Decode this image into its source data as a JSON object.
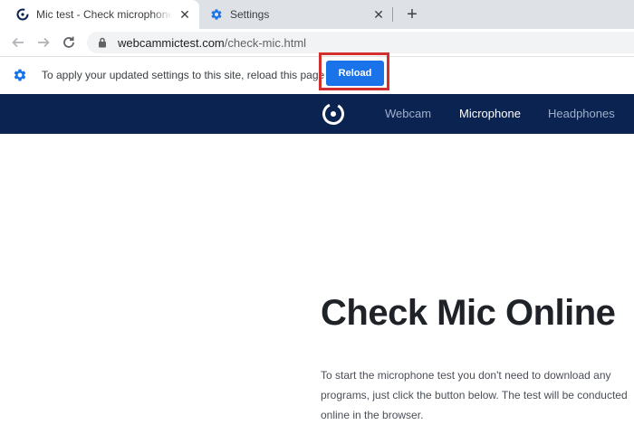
{
  "browser": {
    "tabs": [
      {
        "title": "Mic test - Check microphone online",
        "icon": "site-logo-icon",
        "active": true
      },
      {
        "title": "Settings",
        "icon": "gear-icon",
        "active": false
      }
    ],
    "new_tab_symbol": "+",
    "close_symbol": "✕",
    "address": {
      "host": "webcammictest.com",
      "path": "/check-mic.html"
    }
  },
  "infobar": {
    "message": "To apply your updated settings to this site, reload this page",
    "button_label": "Reload"
  },
  "site_nav": {
    "items": [
      {
        "label": "Webcam"
      },
      {
        "label": "Microphone",
        "current": true
      },
      {
        "label": "Headphones"
      }
    ]
  },
  "main": {
    "heading": "Check Mic Online",
    "intro": "To start the microphone test you don't need to download any programs, just click the button below. The test will be conducted online in the browser."
  },
  "colors": {
    "site_nav_bg": "#0b2350",
    "reload_button": "#1a73e8",
    "highlight_box": "#d32f2f",
    "settings_icon": "#1a73e8"
  }
}
